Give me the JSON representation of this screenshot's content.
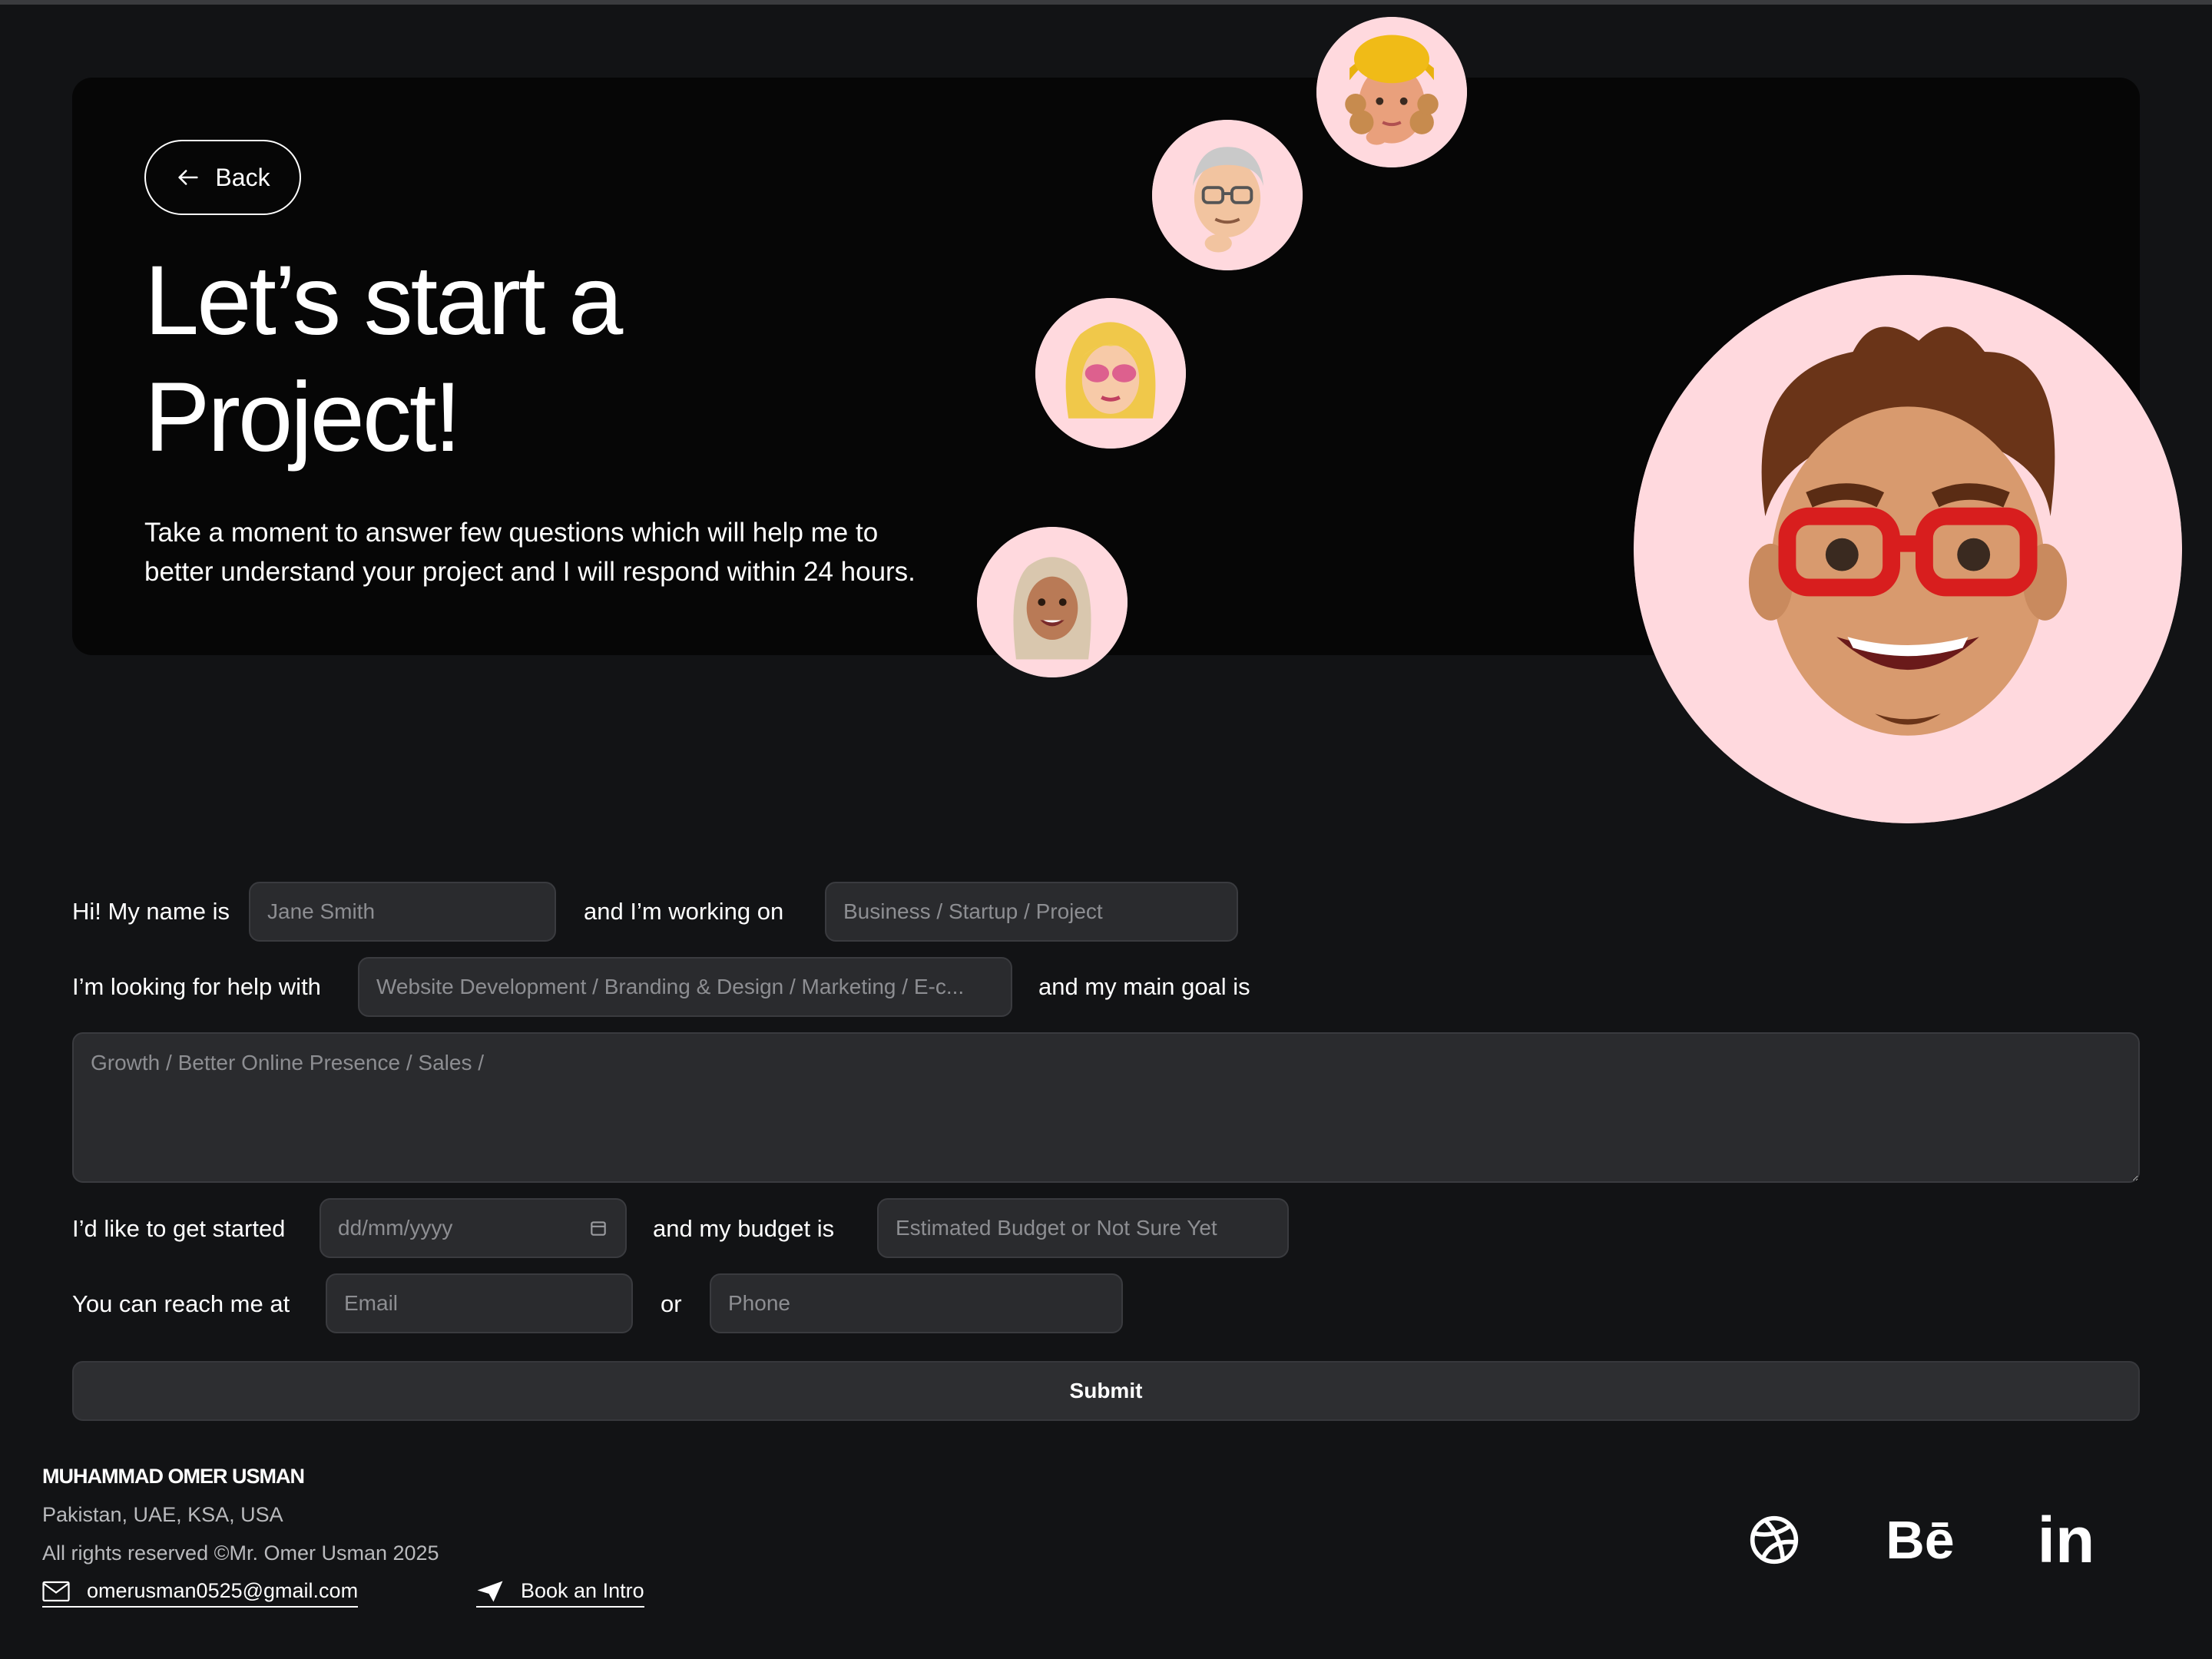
{
  "hero": {
    "back_label": "Back",
    "title_line1": "Let’s start a",
    "title_line2": "Project!",
    "description_line1": "Take a moment to answer few questions which will help me to",
    "description_line2": "better understand your project and I will respond within 24 hours."
  },
  "form": {
    "name_label": "Hi! My name is",
    "name_placeholder": "Jane Smith",
    "working_label": "and I’m working on",
    "working_placeholder": "Business / Startup / Project",
    "help_label": "I’m looking for help with",
    "help_placeholder": "Website Development / Branding & Design / Marketing / E-c...",
    "goal_label": "and my main goal is",
    "goal_placeholder": "Growth / Better Online Presence / Sales /",
    "start_label": "I’d like to get started",
    "date_placeholder": "dd/mm/yyyy",
    "budget_label": "and my budget is",
    "budget_placeholder": "Estimated Budget or Not Sure Yet",
    "reach_label": "You can reach me at",
    "email_placeholder": "Email",
    "or_label": "or",
    "phone_placeholder": "Phone",
    "submit_label": "Submit"
  },
  "footer": {
    "name": "MUHAMMAD OMER USMAN",
    "locations": "Pakistan, UAE, KSA, USA",
    "rights": "All rights reserved ©Mr. Omer Usman 2025",
    "email": "omerusman0525@gmail.com",
    "book_intro": "Book an Intro",
    "social": [
      "dribbble-icon",
      "behance-icon",
      "linkedin-icon"
    ],
    "behance_text": "Bē",
    "linkedin_text": "in"
  },
  "colors": {
    "background": "#121315",
    "hero_background": "#060606",
    "avatar_background": "#ffd9de",
    "field_background": "#2a2b2e"
  }
}
